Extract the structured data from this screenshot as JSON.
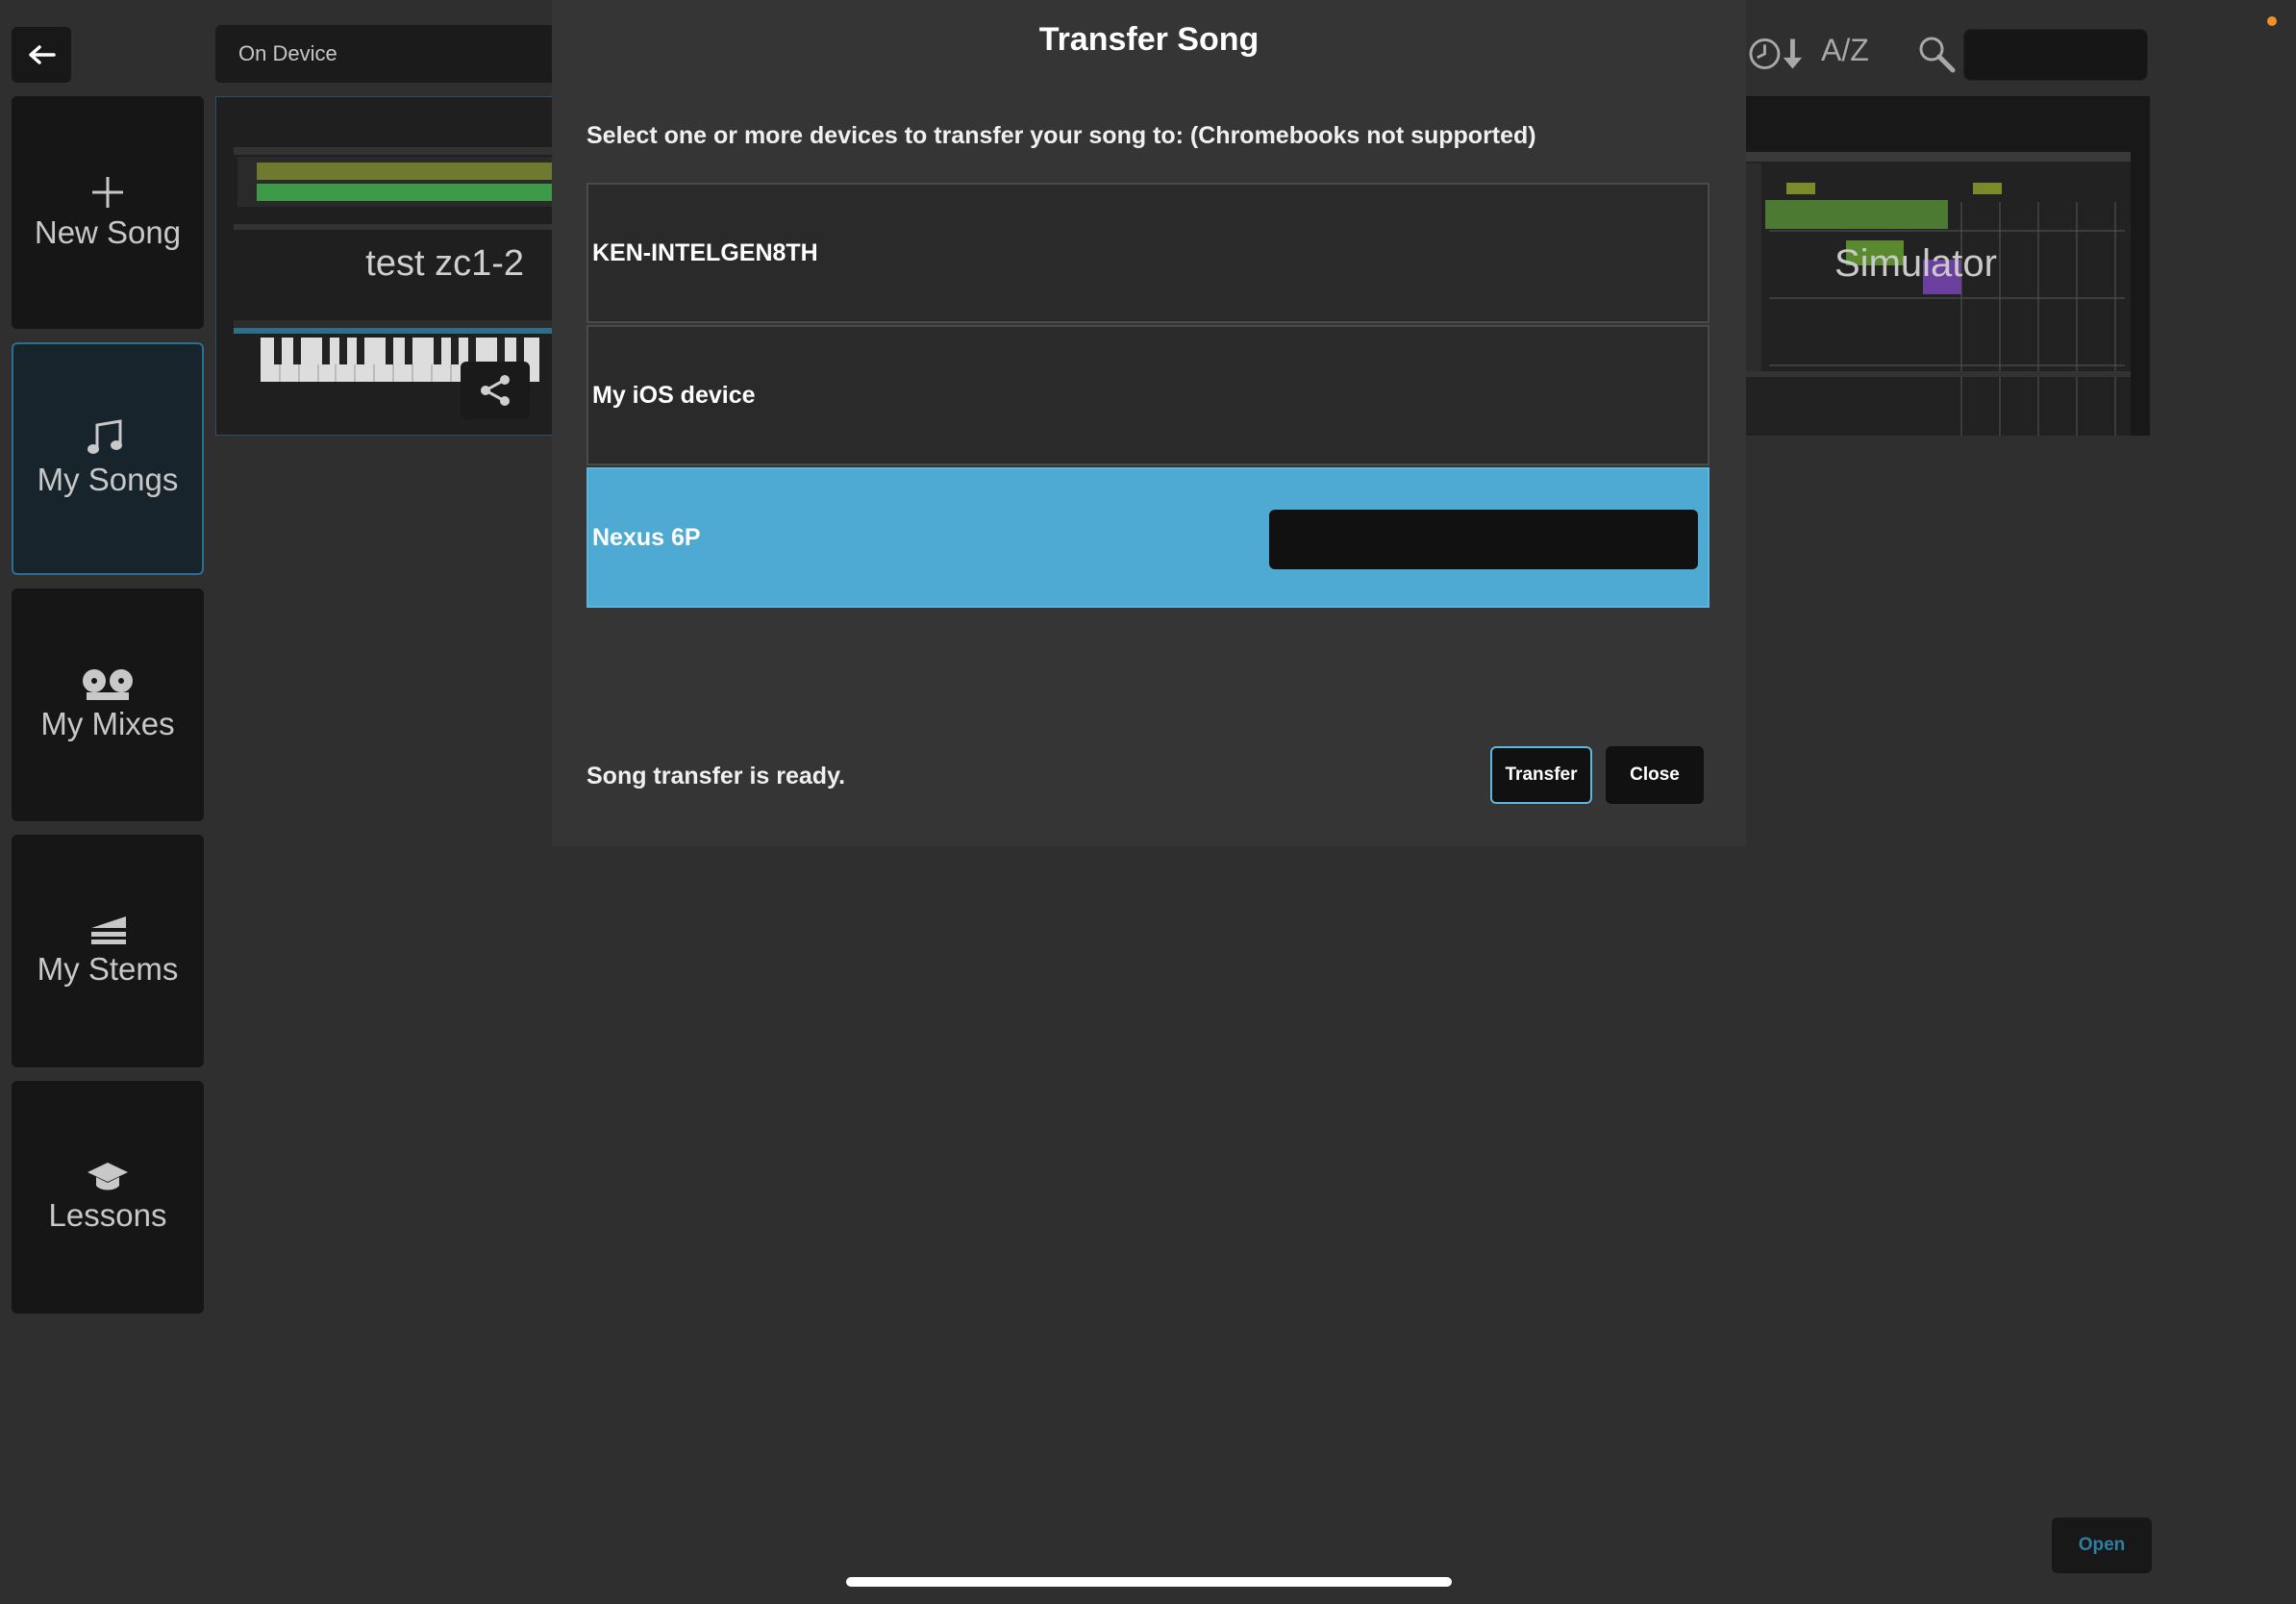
{
  "header": {
    "back_icon": "arrow-left-icon",
    "location_label": "On Device",
    "sort_time_icon": "clock-sort-down-icon",
    "sort_az_label": "A/Z",
    "search_icon": "magnifier-icon"
  },
  "sidebar": {
    "items": [
      {
        "label": "New Song",
        "icon": "plus-icon"
      },
      {
        "label": "My Songs",
        "icon": "music-note-icon"
      },
      {
        "label": "My Mixes",
        "icon": "tape-reels-icon"
      },
      {
        "label": "My Stems",
        "icon": "stems-icon"
      },
      {
        "label": "Lessons",
        "icon": "graduation-cap-icon"
      }
    ],
    "active_index": 1
  },
  "songs": [
    {
      "title": "test zc1-2",
      "share_icon": "share-icon"
    },
    {
      "title": "Simulator"
    }
  ],
  "dialog": {
    "title": "Transfer Song",
    "instruction": "Select one or more devices to transfer your song to: (Chromebooks not supported)",
    "devices": [
      {
        "name": "KEN-INTELGEN8TH",
        "selected": false
      },
      {
        "name": "My iOS device",
        "selected": false
      },
      {
        "name": "Nexus 6P",
        "selected": true
      }
    ],
    "status": "Song transfer is ready.",
    "transfer_label": "Transfer",
    "close_label": "Close"
  },
  "footer": {
    "open_label": "Open"
  },
  "colors": {
    "accent": "#4eaad3",
    "notification_dot": "#f0902a"
  }
}
